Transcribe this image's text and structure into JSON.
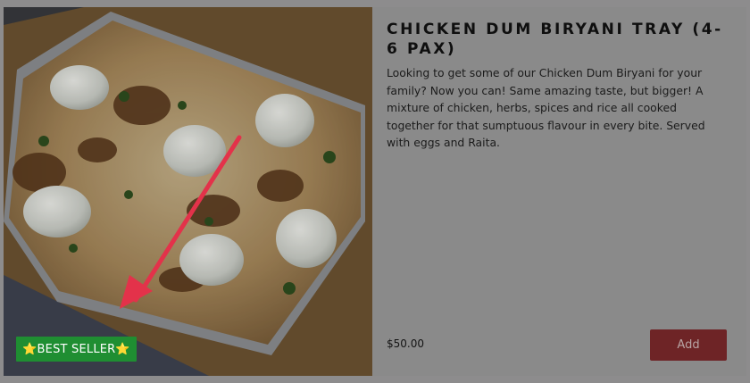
{
  "product": {
    "title": "CHICKEN DUM BIRYANI TRAY (4-6 PAX)",
    "description": "Looking to get some of our Chicken Dum Biryani for your family? Now you can! Same amazing taste, but bigger! A mixture of chicken, herbs, spices and rice all cooked together for that sumptuous flavour in every bite. Served with eggs and Raita.",
    "price": "$50.00",
    "badge": "⭐BEST SELLER⭐",
    "add_label": "Add"
  },
  "colors": {
    "overlay": "#8d8c8d",
    "badge_green": "#1f8e32",
    "add_button": "#6e2426",
    "arrow": "#e3324a"
  },
  "icons": {
    "annotation": "red-arrow-icon"
  }
}
